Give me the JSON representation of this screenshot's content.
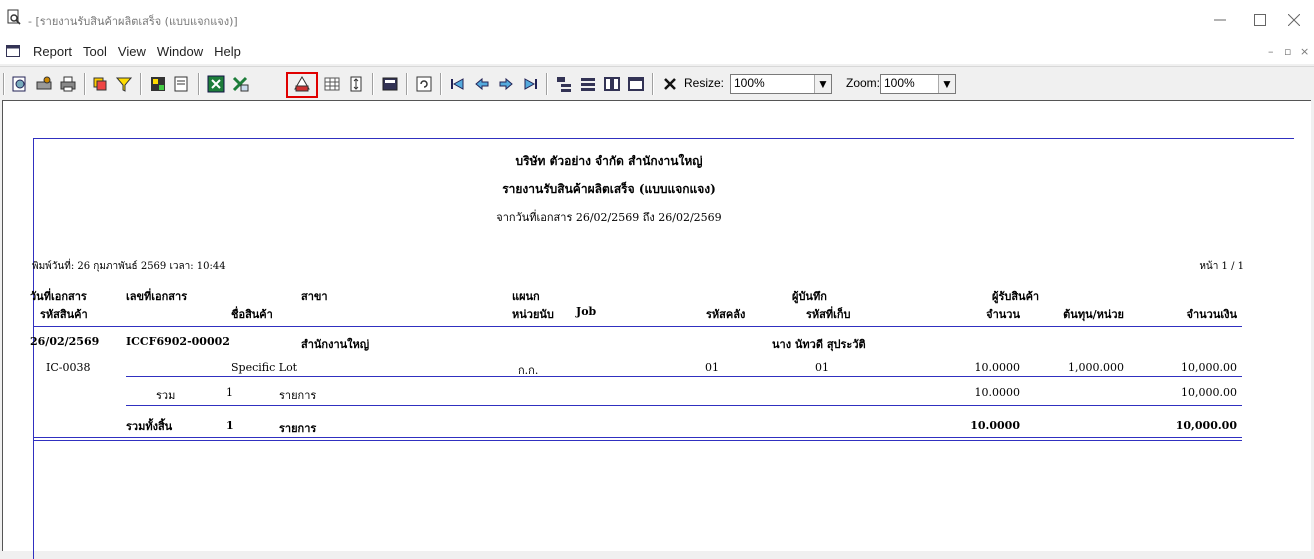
{
  "window": {
    "title": "- [รายงานรับสินค้าผลิตเสร็จ (แบบแจกแจง)]"
  },
  "menu": [
    "Report",
    "Tool",
    "View",
    "Window",
    "Help"
  ],
  "toolbar": {
    "resize_label": "Resize:",
    "resize_value": "100%",
    "zoom_label": "Zoom:",
    "zoom_value": "100%"
  },
  "report": {
    "company": "บริษัท ตัวอย่าง จำกัด   สำนักงานใหญ่",
    "title": "รายงานรับสินค้าผลิตเสร็จ (แบบแจกแจง)",
    "date_range": "จากวันที่เอกสาร 26/02/2569 ถึง 26/02/2569",
    "print_info": "พิมพ์วันที่: 26 กุมภาพันธ์ 2569  เวลา: 10:44",
    "page_info": "หน้า 1 / 1",
    "headers_row1": {
      "doc_date": "วันที่เอกสาร",
      "doc_no": "เลขที่เอกสาร",
      "branch": "สาขา",
      "department": "แผนก",
      "recorder": "ผู้บันทึก",
      "receiver": "ผู้รับสินค้า"
    },
    "headers_row2": {
      "item_code": "รหัสสินค้า",
      "item_name": "ชื่อสินค้า",
      "unit": "หน่วยนับ",
      "job": "Job",
      "warehouse": "รหัสคลัง",
      "location": "รหัสที่เก็บ",
      "qty": "จำนวน",
      "cost_unit": "ต้นทุน/หน่วย",
      "amount": "จำนวนเงิน"
    },
    "doc": {
      "date": "26/02/2569",
      "no": "ICCF6902-00002",
      "branch": "สำนักงานใหญ่",
      "recorder": "นาง นัทวดี สุประวัติ"
    },
    "item": {
      "code": "IC-0038",
      "name": "Specific Lot",
      "unit": "ก.ก.",
      "warehouse": "01",
      "location": "01",
      "qty": "10.0000",
      "cost_unit": "1,000.000",
      "amount": "10,000.00"
    },
    "subtotal": {
      "label": "รวม",
      "count": "1",
      "unit_label": "รายการ",
      "qty": "10.0000",
      "amount": "10,000.00"
    },
    "grandtotal": {
      "label": "รวมทั้งสิ้น",
      "count": "1",
      "unit_label": "รายการ",
      "qty": "10.0000",
      "amount": "10,000.00"
    }
  }
}
